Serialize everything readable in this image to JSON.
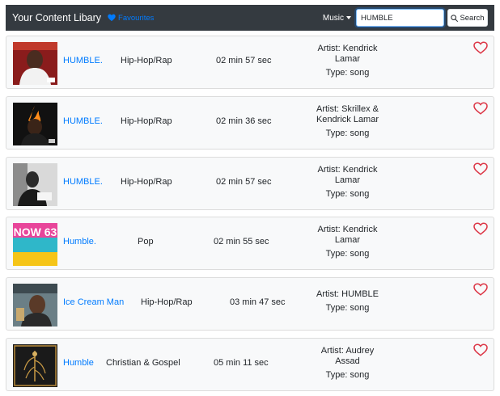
{
  "navbar": {
    "brand": "Your Content Libary",
    "favourites_label": "Favourites",
    "music_label": "Music",
    "search_value": "HUMBLE",
    "search_button": "Search"
  },
  "colors": {
    "accent": "#007bff",
    "navbar": "#343a40",
    "heart": "#dc3545"
  },
  "results": [
    {
      "title": "HUMBLE.",
      "genre": "Hip-Hop/Rap",
      "duration": "02 min 57 sec",
      "artist_line1": "Artist: Kendrick",
      "artist_line2": "Lamar",
      "type": "Type: song",
      "icon": "heart-outline-icon"
    },
    {
      "title": "HUMBLE.",
      "genre": "Hip-Hop/Rap",
      "duration": "02 min 36 sec",
      "artist_line1": "Artist: Skrillex &",
      "artist_line2": "Kendrick Lamar",
      "type": "Type: song",
      "icon": "heart-outline-icon"
    },
    {
      "title": "HUMBLE.",
      "genre": "Hip-Hop/Rap",
      "duration": "02 min 57 sec",
      "artist_line1": "Artist: Kendrick",
      "artist_line2": "Lamar",
      "type": "Type: song",
      "icon": "heart-outline-icon"
    },
    {
      "title": "Humble.",
      "genre": "Pop",
      "duration": "02 min 55 sec",
      "artist_line1": "Artist: Kendrick",
      "artist_line2": "Lamar",
      "type": "Type: song",
      "icon": "heart-outline-icon",
      "art_text": "NOW 63"
    },
    {
      "title": "Ice Cream Man",
      "genre": "Hip-Hop/Rap",
      "duration": "03 min 47 sec",
      "artist_line1": "Artist: HUMBLE",
      "artist_line2": "",
      "type": "Type: song",
      "icon": "heart-outline-icon"
    },
    {
      "title": "Humble",
      "genre": "Christian & Gospel",
      "duration": "05 min 11 sec",
      "artist_line1": "Artist: Audrey",
      "artist_line2": "Assad",
      "type": "Type: song",
      "icon": "heart-outline-icon"
    }
  ]
}
